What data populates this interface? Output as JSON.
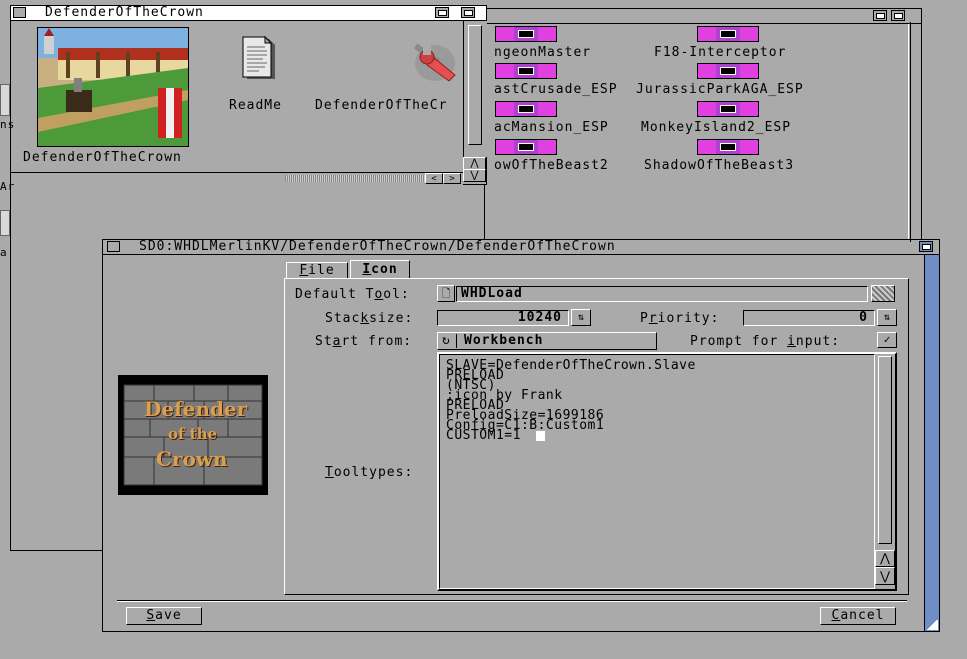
{
  "window_title_back": "DefenderOfTheCrown",
  "drawer_icons": [
    {
      "label": "DefenderOfTheCrown"
    },
    {
      "label": "ReadMe"
    },
    {
      "label": "DefenderOfTheCr"
    }
  ],
  "bg_icons": [
    {
      "label": "ngeonMaster"
    },
    {
      "label": "F18-Interceptor"
    },
    {
      "label": "astCrusade_ESP"
    },
    {
      "label": "JurassicParkAGA_ESP"
    },
    {
      "label": "acMansion_ESP"
    },
    {
      "label": "MonkeyIsland2_ESP"
    },
    {
      "label": "owOfTheBeast2"
    },
    {
      "label": "ShadowOfTheBeast3"
    }
  ],
  "left_edge_labels": [
    "ns",
    "Ar",
    "a"
  ],
  "info_window": {
    "title": "SD0:WHDLMerlinKV/DefenderOfTheCrown/DefenderOfTheCrown",
    "tabs": [
      {
        "label": "File",
        "underline": "F",
        "rest": "ile"
      },
      {
        "label": "Icon",
        "underline": "I",
        "rest": "con"
      }
    ],
    "default_tool": {
      "pre": "Default T",
      "u": "o",
      "post": "ol:",
      "value": "WHDLoad"
    },
    "stacksize": {
      "pre": "Stac",
      "u": "k",
      "post": "size:",
      "value": "10240"
    },
    "priority": {
      "pre": "P",
      "u": "r",
      "post": "iority:",
      "value": "0"
    },
    "start_from": {
      "pre": "St",
      "u": "a",
      "post": "rt from:",
      "value": "Workbench"
    },
    "prompt_for_input": {
      "pre": "Prompt for ",
      "u": "i",
      "post": "nput:"
    },
    "tooltypes_label": {
      "u": "T",
      "post": "ooltypes:"
    },
    "tooltypes": "SLAVE=DefenderOfTheCrown.Slave\nPRELOAD\n(NTSC)\n;icon by Frank\nPRELOAD\nPreloadSize=1699186\nConfig=C1:B:Custom1\nCUSTOM1=1",
    "save_button": {
      "u": "S",
      "post": "ave"
    },
    "cancel_button": {
      "u": "C",
      "post": "ancel"
    },
    "preview_logo": [
      "Defender",
      "of the",
      "Crown"
    ]
  },
  "colors": {
    "workbench_gray": "#aaaaaa",
    "title_blue": "#6f8fc4",
    "icon_magenta": "#e040e0"
  }
}
